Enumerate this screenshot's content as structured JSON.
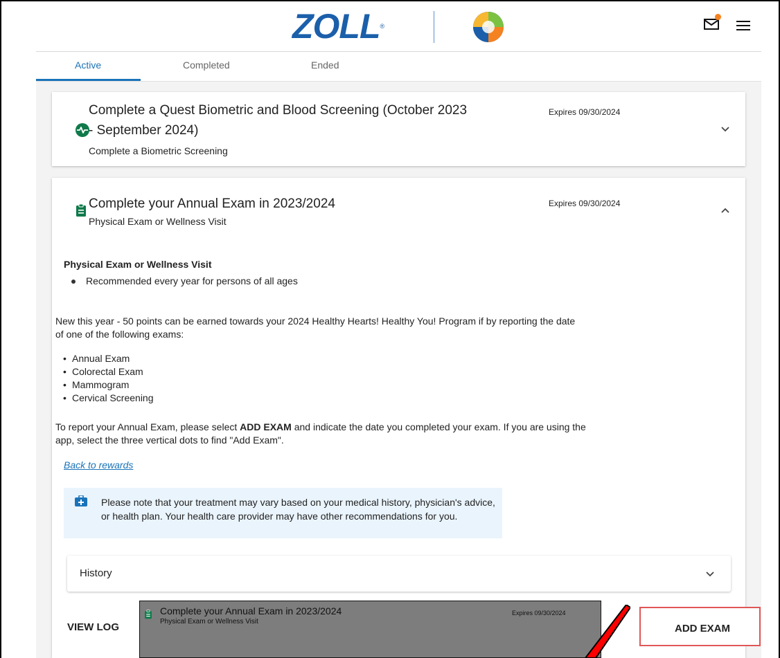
{
  "header": {
    "brand_text": "ZOLL",
    "brand_reg": "®",
    "mail_icon": "mail-icon",
    "menu_icon": "hamburger-menu-icon",
    "brand_color": "#1b5faa",
    "notification_color": "#f58220"
  },
  "tabs": [
    {
      "label": "Active",
      "active": true
    },
    {
      "label": "Completed",
      "active": false
    },
    {
      "label": "Ended",
      "active": false
    }
  ],
  "card1": {
    "icon": "activity-icon",
    "title_line1": "Complete a Quest Biometric and Blood Screening (October 2023",
    "title_line2": "- September 2024)",
    "subtitle": "Complete a Biometric Screening",
    "expires": "Expires 09/30/2024",
    "expanded": false
  },
  "card2": {
    "icon": "clipboard-icon",
    "title": "Complete your Annual Exam in 2023/2024",
    "subtitle": "Physical Exam or Wellness Visit",
    "expires": "Expires 09/30/2024",
    "expanded": true,
    "section_heading": "Physical Exam or Wellness Visit",
    "recommendation": "Recommended every year for persons of all ages",
    "intro_line1": "New this year - 50 points can be earned towards your 2024 Healthy Hearts! Healthy You! Program if by reporting the date",
    "intro_line2": "of one of the following exams:",
    "exams": [
      "Annual Exam",
      "Colorectal Exam",
      "Mammogram",
      "Cervical Screening"
    ],
    "report_pre": "To report your Annual Exam, please select ",
    "report_bold": "ADD EXAM",
    "report_post": " and indicate the date you completed your exam. If you are using the",
    "report_line2": "app, select the three vertical dots to find \"Add Exam\".",
    "back_link": "Back to rewards",
    "note": "Please note that your treatment may vary based on your medical history, physician's advice, or health plan. Your health care provider may have other recommendations for you.",
    "history_label": "History",
    "view_log": "VIEW LOG",
    "add_exam": "ADD EXAM"
  },
  "ghost": {
    "title": "Complete your Annual Exam in 2023/2024",
    "subtitle": "Physical Exam or Wellness Visit",
    "expires": "Expires 09/30/2024"
  },
  "colors": {
    "accent": "#1a73b8",
    "icon_green": "#0f7a4a",
    "highlight_box": "#e05656",
    "arrow": "#ff0000",
    "note_bg": "#eaf4fc"
  }
}
